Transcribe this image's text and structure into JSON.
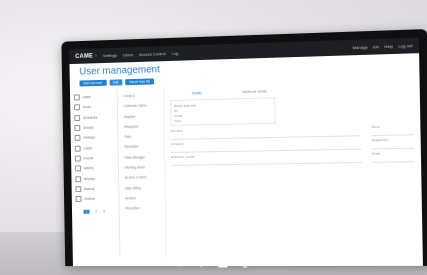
{
  "app": {
    "logo_text": "CAME",
    "header_nav": [
      "Settings",
      "Users",
      "Access Control",
      "Log"
    ],
    "header_right": [
      "Manage",
      "EN",
      "Help",
      "Log out"
    ]
  },
  "page": {
    "title": "User management"
  },
  "toolbar": {
    "buttons": [
      "Add new user",
      "Edit",
      "Import from file"
    ]
  },
  "sidebar": {
    "items": [
      "Users",
      "Doors",
      "Schedules",
      "Groups",
      "Holidays",
      "Cards",
      "Events",
      "Alarms",
      "Reports",
      "Backup",
      "Archive"
    ],
    "pagination": [
      "1",
      "2",
      "3"
    ]
  },
  "list": {
    "items": [
      "Group A",
      "Customer Name",
      "Supplier",
      "Reception",
      "Pass",
      "Reception",
      "Pass Manager",
      "Working hours",
      "Access Control",
      "Main Office",
      "Archive",
      "Reception"
    ]
  },
  "detail": {
    "tabs": [
      "Details",
      "Additional details"
    ],
    "box_rows": [
      "Badge data user",
      "ID",
      "Group",
      "Type"
    ],
    "fields": [
      {
        "label": "Surname",
        "value": ""
      },
      {
        "label": "Name",
        "value": ""
      },
      {
        "label": "Company",
        "value": ""
      },
      {
        "label": "Department",
        "value": ""
      },
      {
        "label": "Employee number",
        "value": ""
      },
      {
        "label": "Email",
        "value": ""
      }
    ]
  },
  "colors": {
    "accent": "#2f7fcf",
    "header_bg": "#1c1f23",
    "button_bg": "#1f7fd1"
  },
  "taskbar": {
    "icons": [
      "speaker-icon",
      "microphone-icon",
      "person-icon",
      "screen-share-icon",
      "video-camera-icon"
    ]
  }
}
